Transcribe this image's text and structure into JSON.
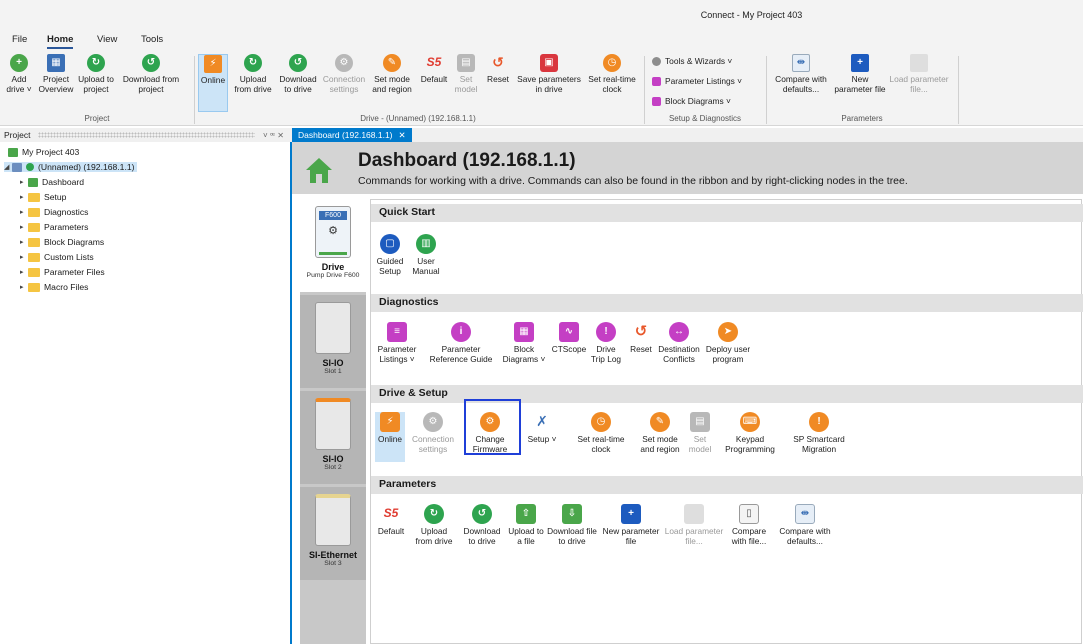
{
  "window": {
    "title": "Connect - My Project 403"
  },
  "ribbon": {
    "tabs": [
      "File",
      "Home",
      "View",
      "Tools"
    ],
    "buttons": {
      "add_drive": "Add drive ˅",
      "project_overview": "Project Overview",
      "upload_to_project": "Upload to project",
      "download_from_project": "Download from project",
      "online": "Online",
      "upload_from_drive": "Upload from drive",
      "download_to_drive": "Download to drive",
      "connection_settings": "Connection settings",
      "set_mode_region": "Set mode and region",
      "default": "Default",
      "set_model": "Set model",
      "reset": "Reset",
      "save_parameters": "Save parameters in drive",
      "set_rtc": "Set real-time clock",
      "tools_wizards": "Tools & Wizards ˅",
      "parameter_listings": "Parameter Listings ˅",
      "block_diagrams": "Block Diagrams ˅",
      "compare_defaults": "Compare with defaults...",
      "new_param_file": "New parameter file",
      "load_param_file": "Load parameter file..."
    },
    "groups": {
      "project": "Project",
      "drive": "Drive - (Unnamed) (192.168.1.1)",
      "setup": "Setup & Diagnostics",
      "parameters": "Parameters"
    }
  },
  "project_pane": {
    "title": "Project",
    "controls": "˅ ꟹ ✕",
    "tree": {
      "root": "My Project 403",
      "drive": "(Unnamed) (192.168.1.1)",
      "children": [
        "Dashboard",
        "Setup",
        "Diagnostics",
        "Parameters",
        "Block Diagrams",
        "Custom Lists",
        "Parameter Files",
        "Macro Files"
      ]
    }
  },
  "doc_tab": {
    "label": "Dashboard (192.168.1.1)",
    "close": "✕"
  },
  "dashboard": {
    "title": "Dashboard (192.168.1.1)",
    "subtitle": "Commands for working with a drive. Commands can also be found in the ribbon and by right-clicking nodes in the tree.",
    "slots": [
      {
        "badge": "F600",
        "name": "Drive",
        "sub": "Pump Drive F600"
      },
      {
        "name": "SI-IO",
        "sub": "Slot 1"
      },
      {
        "name": "SI-IO",
        "sub": "Slot 2"
      },
      {
        "name": "SI-Ethernet",
        "sub": "Slot 3"
      }
    ],
    "sections": {
      "quick_start": "Quick Start",
      "diagnostics": "Diagnostics",
      "drive_setup": "Drive & Setup",
      "parameters": "Parameters"
    },
    "quick_start": {
      "guided_setup": "Guided Setup",
      "user_manual": "User Manual"
    },
    "diagnostics": {
      "parameter_listings": "Parameter Listings ˅",
      "param_ref_guide": "Parameter Reference Guide",
      "block_diagrams": "Block Diagrams ˅",
      "ctscope": "CTScope",
      "trip_log": "Drive Trip Log",
      "reset": "Reset",
      "dest_conflicts": "Destination Conflicts",
      "deploy_user": "Deploy user program"
    },
    "drive_setup": {
      "online": "Online",
      "connection_settings": "Connection settings",
      "change_firmware": "Change Firmware",
      "setup": "Setup ˅",
      "set_rtc": "Set real-time clock",
      "set_mode": "Set mode and region",
      "set_model": "Set model",
      "keypad": "Keypad Programming",
      "sp_migration": "SP Smartcard Migration"
    },
    "parameters": {
      "default": "Default",
      "upload_from_drive": "Upload from drive",
      "download_to_drive": "Download to drive",
      "upload_file": "Upload to a file",
      "download_file": "Download file to drive",
      "new_param_file": "New parameter file",
      "load_param_file": "Load parameter file...",
      "compare_file": "Compare with file...",
      "compare_defaults": "Compare with defaults..."
    }
  }
}
